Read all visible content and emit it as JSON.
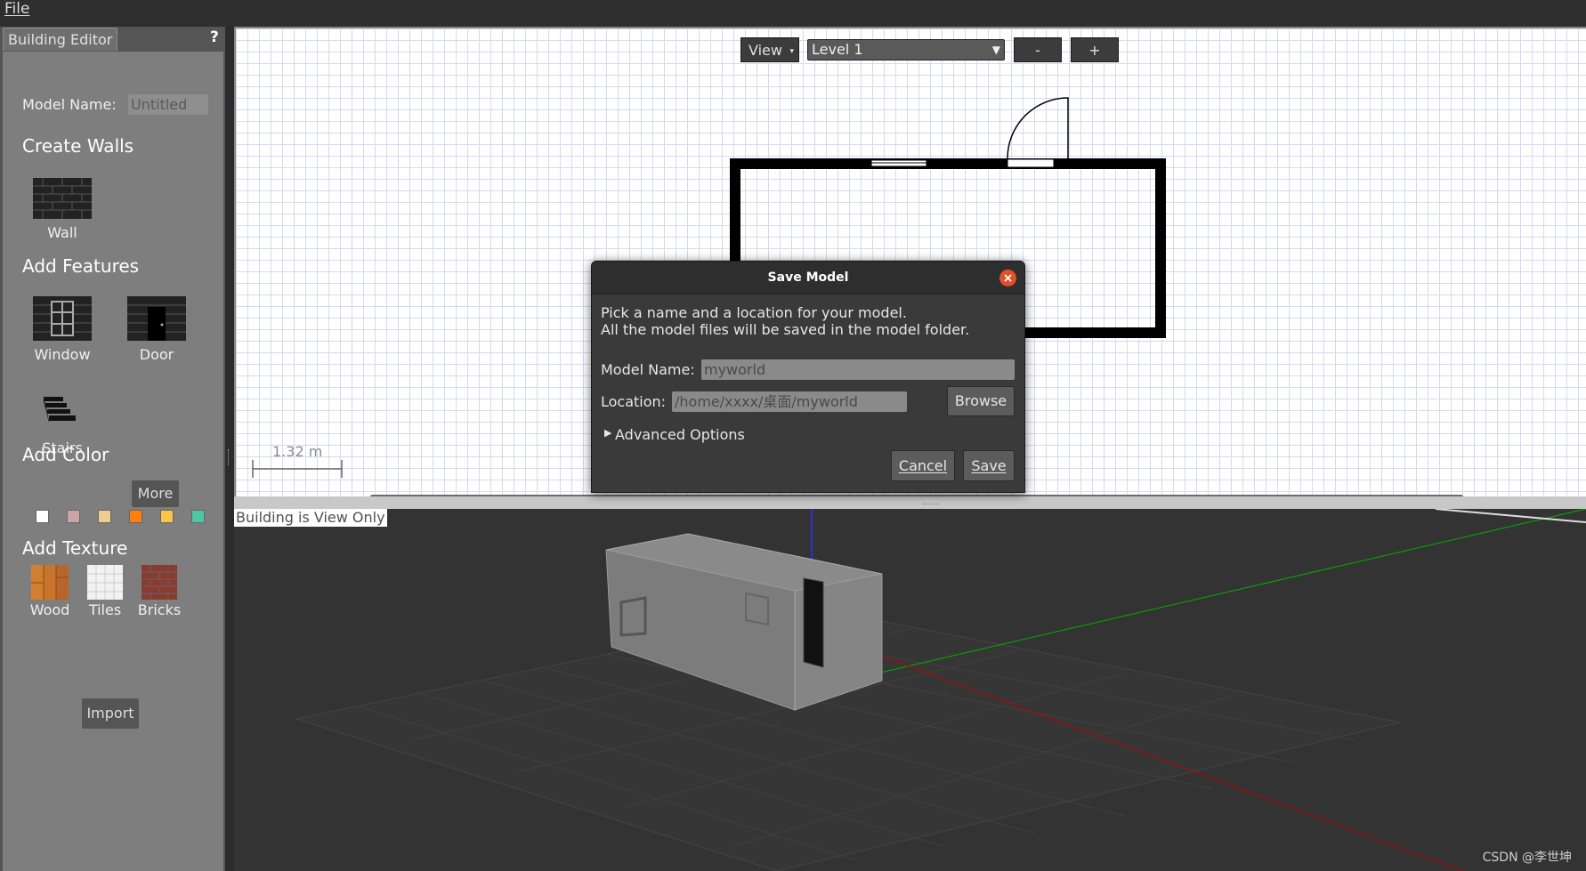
{
  "menubar": {
    "file": "File"
  },
  "left_panel": {
    "tab": "Building Editor",
    "help": "?",
    "model_name_label": "Model Name:",
    "model_name_value": "Untitled",
    "create_walls_heading": "Create Walls",
    "wall_label": "Wall",
    "add_features_heading": "Add Features",
    "window_label": "Window",
    "door_label": "Door",
    "stairs_label": "Stairs",
    "add_color_heading": "Add Color",
    "colors": [
      "#ffffff",
      "#c9a5a5",
      "#f0cc8e",
      "#ff7f10",
      "#fbc54a",
      "#4dc8a0"
    ],
    "more_button": "More",
    "add_texture_heading": "Add Texture",
    "wood_label": "Wood",
    "tiles_label": "Tiles",
    "bricks_label": "Bricks",
    "import_button": "Import"
  },
  "editor2d": {
    "view_button": "View",
    "level_select": "Level 1",
    "zoom_out": "-",
    "zoom_in": "+",
    "scale_label": "1.32 m"
  },
  "view3d": {
    "status": "Building is View Only",
    "watermark": "CSDN @李世坤"
  },
  "dialog": {
    "title": "Save Model",
    "line1": "Pick a name and a location for your model.",
    "line2": "All the model files will be saved in the model folder.",
    "model_name_label": "Model Name:",
    "model_name_value": "myworld",
    "location_label": "Location:",
    "location_value": "/home/xxxx/桌面/myworld",
    "browse_button": "Browse",
    "advanced_options": "Advanced Options",
    "cancel_button": "Cancel",
    "save_button": "Save"
  }
}
